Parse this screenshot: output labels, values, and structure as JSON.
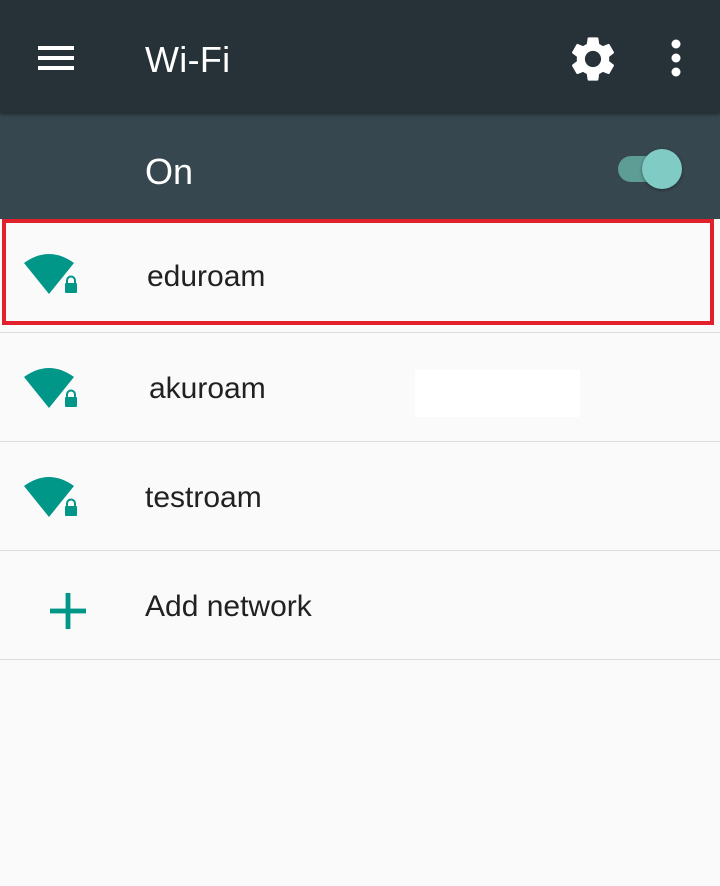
{
  "appbar": {
    "title": "Wi-Fi",
    "background": "#263238",
    "icons": [
      "menu-icon",
      "gear-icon",
      "more-vert-icon"
    ]
  },
  "switchbar": {
    "label": "On",
    "state": "on",
    "background": "#37474f",
    "accent": "#80cbc4"
  },
  "networks": [
    {
      "ssid": "eduroam",
      "icon": "wifi-lock-icon",
      "highlighted": true
    },
    {
      "ssid": "akuroam",
      "icon": "wifi-lock-icon"
    },
    {
      "ssid": "testroam",
      "icon": "wifi-lock-icon"
    }
  ],
  "add_network": {
    "label": "Add network",
    "icon": "plus-icon"
  },
  "colors": {
    "wifi_icon": "#009688",
    "highlight_border": "#e0202a",
    "list_background": "#fafafa"
  }
}
